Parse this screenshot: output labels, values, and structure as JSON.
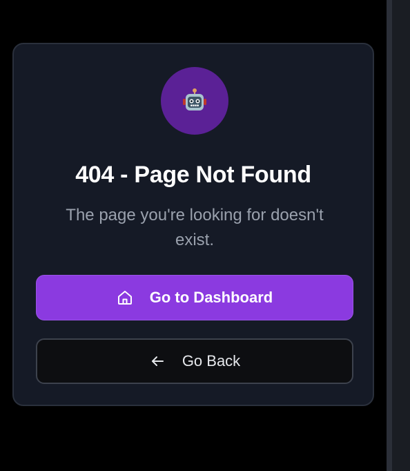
{
  "error_card": {
    "title": "404 - Page Not Found",
    "message": "The page you're looking for doesn't exist.",
    "avatar_icon": "robot-icon"
  },
  "actions": {
    "dashboard": {
      "label": "Go to Dashboard",
      "icon": "home-icon"
    },
    "back": {
      "label": "Go Back",
      "icon": "arrow-left-icon"
    }
  },
  "colors": {
    "background": "#000000",
    "card_background": "#151a26",
    "card_border": "#2a303c",
    "avatar_background": "#5b2196",
    "primary_button": "#8b3ae0",
    "secondary_button": "#0d0e11",
    "title_text": "#ffffff",
    "message_text": "#9aa1ad"
  }
}
